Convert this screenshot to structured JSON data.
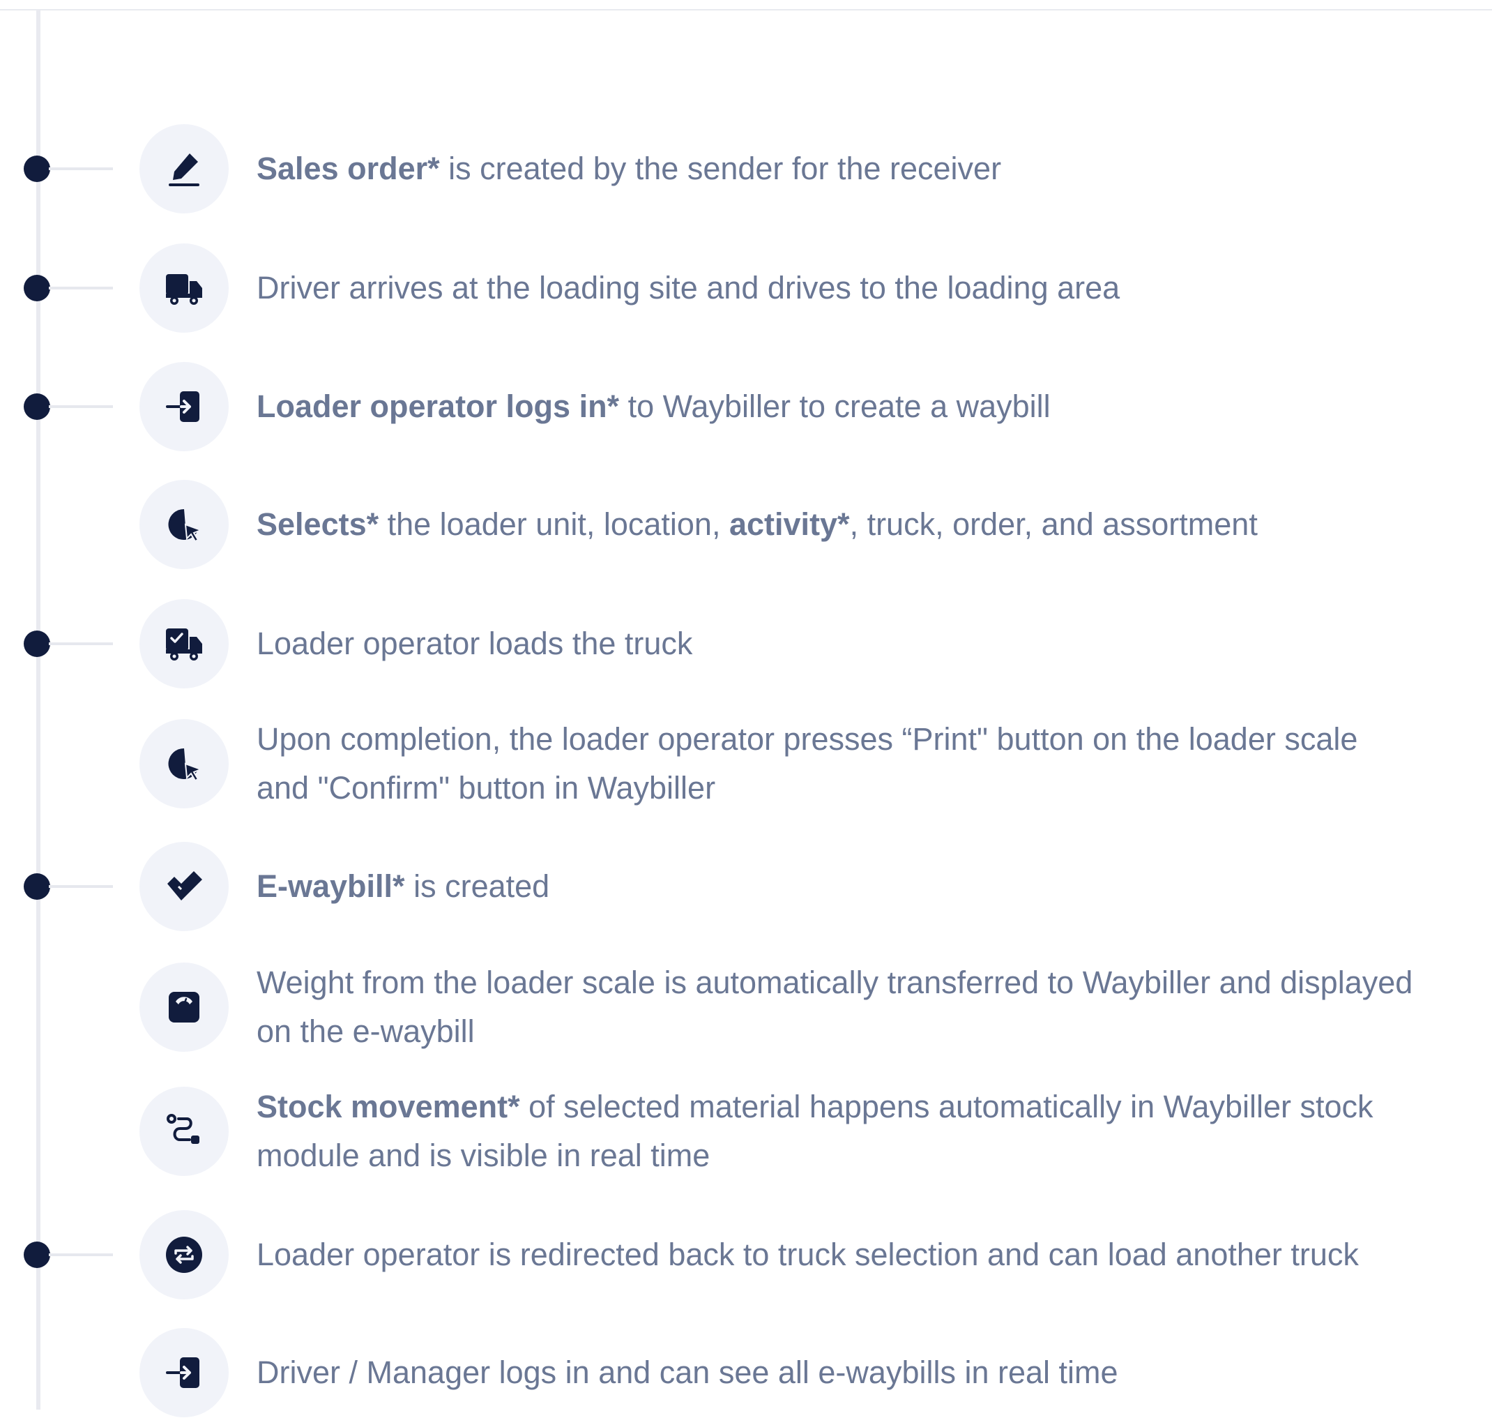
{
  "steps": [
    {
      "id": "sales-order",
      "has_dot": true,
      "icon": "pen-sign-icon",
      "lines": [
        [
          {
            "t": "Sales order*",
            "b": true
          },
          {
            "t": " is created by the sender for the receiver",
            "b": false
          }
        ]
      ]
    },
    {
      "id": "driver-arrives",
      "has_dot": true,
      "icon": "truck-icon",
      "lines": [
        [
          {
            "t": "Driver arrives at the loading site and drives to the loading area",
            "b": false
          }
        ]
      ]
    },
    {
      "id": "loader-login",
      "has_dot": true,
      "icon": "login-icon",
      "lines": [
        [
          {
            "t": "Loader operator logs in*",
            "b": true
          },
          {
            "t": " to Waybiller to create a waybill",
            "b": false
          }
        ]
      ]
    },
    {
      "id": "selects",
      "has_dot": false,
      "icon": "pointer-select-icon",
      "lines": [
        [
          {
            "t": "Selects*",
            "b": true
          },
          {
            "t": " the loader unit, location, ",
            "b": false
          },
          {
            "t": "activity*",
            "b": true
          },
          {
            "t": ", truck, order, and assortment",
            "b": false
          }
        ]
      ]
    },
    {
      "id": "loads-truck",
      "has_dot": true,
      "icon": "truck-loaded-icon",
      "lines": [
        [
          {
            "t": "Loader operator loads the truck",
            "b": false
          }
        ]
      ]
    },
    {
      "id": "print-confirm",
      "has_dot": false,
      "icon": "pointer-select-icon",
      "lines": [
        [
          {
            "t": "Upon completion, the loader operator presses “Print\" button on the loader scale",
            "b": false
          }
        ],
        [
          {
            "t": "and \"Confirm\" button in Waybiller",
            "b": false
          }
        ]
      ]
    },
    {
      "id": "ewaybill-created",
      "has_dot": true,
      "icon": "checkmark-icon",
      "lines": [
        [
          {
            "t": "E-waybill*",
            "b": true
          },
          {
            "t": " is created",
            "b": false
          }
        ]
      ]
    },
    {
      "id": "weight-transfer",
      "has_dot": false,
      "icon": "scale-icon",
      "lines": [
        [
          {
            "t": "Weight from the loader scale is automatically transferred to Waybiller and displayed",
            "b": false
          }
        ],
        [
          {
            "t": "on the e-waybill",
            "b": false
          }
        ]
      ]
    },
    {
      "id": "stock-movement",
      "has_dot": false,
      "icon": "route-icon",
      "lines": [
        [
          {
            "t": "Stock movement*",
            "b": true
          },
          {
            "t": " of selected material happens automatically in Waybiller stock",
            "b": false
          }
        ],
        [
          {
            "t": "module and is visible in real time",
            "b": false
          }
        ]
      ]
    },
    {
      "id": "redirected",
      "has_dot": true,
      "icon": "repeat-icon",
      "lines": [
        [
          {
            "t": "Loader operator is redirected back to truck selection and can load another truck",
            "b": false
          }
        ]
      ]
    },
    {
      "id": "driver-manager-login",
      "has_dot": false,
      "icon": "login-icon",
      "lines": [
        [
          {
            "t": "Driver / Manager logs in and can see all e-waybills in real time",
            "b": false
          }
        ]
      ]
    }
  ]
}
